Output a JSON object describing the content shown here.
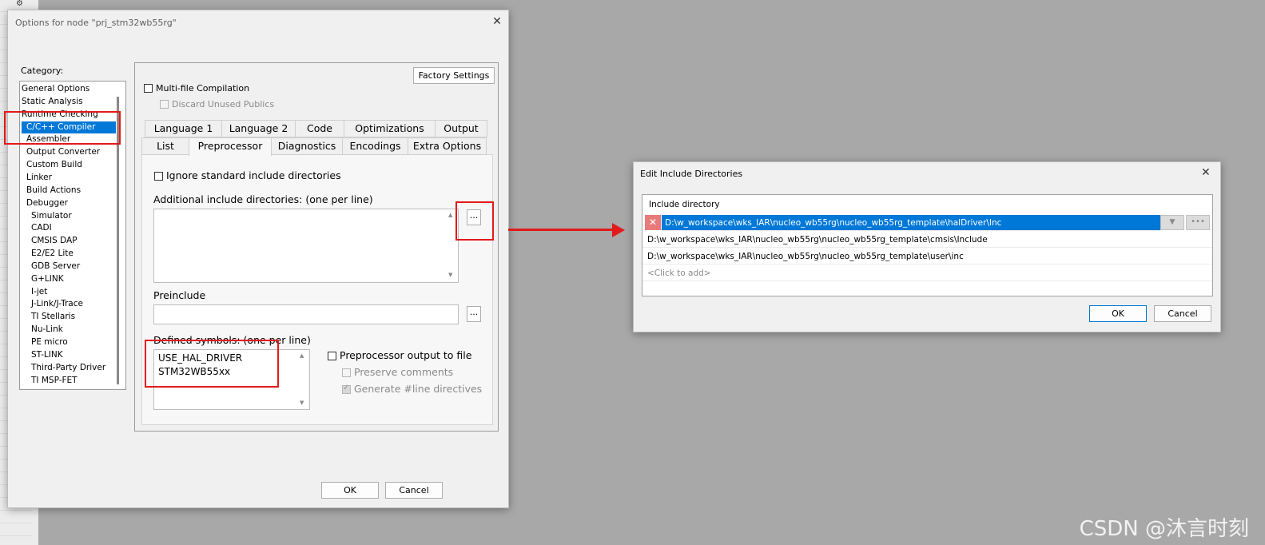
{
  "background": {
    "watermark": "CSDN @沐言时刻"
  },
  "options_dialog": {
    "title": "Options for node \"prj_stm32wb55rg\"",
    "category_label": "Category:",
    "categories": [
      "General Options",
      "Static Analysis",
      "Runtime Checking",
      "C/C++ Compiler",
      "Assembler",
      "Output Converter",
      "Custom Build",
      "Linker",
      "Build Actions",
      "Debugger",
      "Simulator",
      "CADI",
      "CMSIS DAP",
      "E2/E2 Lite",
      "GDB Server",
      "G+LINK",
      "I-jet",
      "J-Link/J-Trace",
      "TI Stellaris",
      "Nu-Link",
      "PE micro",
      "ST-LINK",
      "Third-Party Driver",
      "TI MSP-FET"
    ],
    "selected_category": "C/C++ Compiler",
    "factory_settings": "Factory Settings",
    "multifile": "Multi-file Compilation",
    "discard_unused": "Discard Unused Publics",
    "tabs_row1": [
      "Language 1",
      "Language 2",
      "Code",
      "Optimizations",
      "Output"
    ],
    "tabs_row2": [
      "List",
      "Preprocessor",
      "Diagnostics",
      "Encodings",
      "Extra Options"
    ],
    "active_tab": "Preprocessor",
    "ignore_std": "Ignore standard include directories",
    "additional_include_label": "Additional include directories: (one per line)",
    "browse_label": "...",
    "preinclude_label": "Preinclude",
    "defined_symbols_label": "Defined symbols: (one per line)",
    "defined_symbols": [
      "USE_HAL_DRIVER",
      "STM32WB55xx"
    ],
    "preproc_output": "Preprocessor output to file",
    "preserve_comments": "Preserve comments",
    "generate_line": "Generate #line directives",
    "ok": "OK",
    "cancel": "Cancel"
  },
  "include_dialog": {
    "title": "Edit Include Directories",
    "column_header": "Include directory",
    "rows": [
      "D:\\w_workspace\\wks_IAR\\nucleo_wb55rg\\nucleo_wb55rg_template\\halDriver\\Inc",
      "D:\\w_workspace\\wks_IAR\\nucleo_wb55rg\\nucleo_wb55rg_template\\cmsis\\Include",
      "D:\\w_workspace\\wks_IAR\\nucleo_wb55rg\\nucleo_wb55rg_template\\user\\inc"
    ],
    "add_placeholder": "<Click to add>",
    "ok": "OK",
    "cancel": "Cancel"
  },
  "colors": {
    "highlight": "#0078d7",
    "annotation": "#e31a1a"
  }
}
